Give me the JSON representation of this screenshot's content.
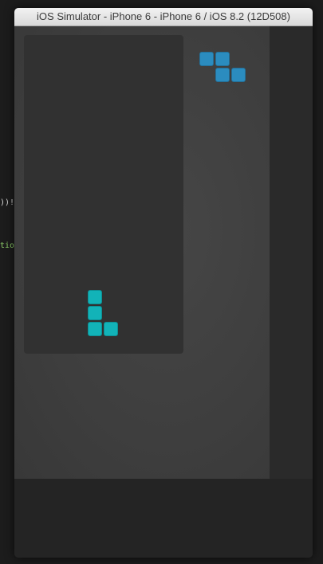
{
  "editor": {
    "fragment_1": "))!",
    "fragment_2": "tio"
  },
  "window": {
    "title": "iOS Simulator - iPhone 6 - iPhone 6 / iOS 8.2 (12D508)"
  },
  "game": {
    "board": {
      "columns": 10,
      "rows": 20,
      "active_piece": {
        "shape": "L",
        "color": "#12b3b8",
        "cells": [
          [
            4,
            16
          ],
          [
            4,
            17
          ],
          [
            4,
            18
          ],
          [
            5,
            18
          ]
        ]
      }
    },
    "next_piece": {
      "shape": "Z",
      "color": "#2b8cbf",
      "cells": [
        [
          0,
          0
        ],
        [
          1,
          0
        ],
        [
          1,
          1
        ],
        [
          2,
          1
        ]
      ]
    }
  }
}
